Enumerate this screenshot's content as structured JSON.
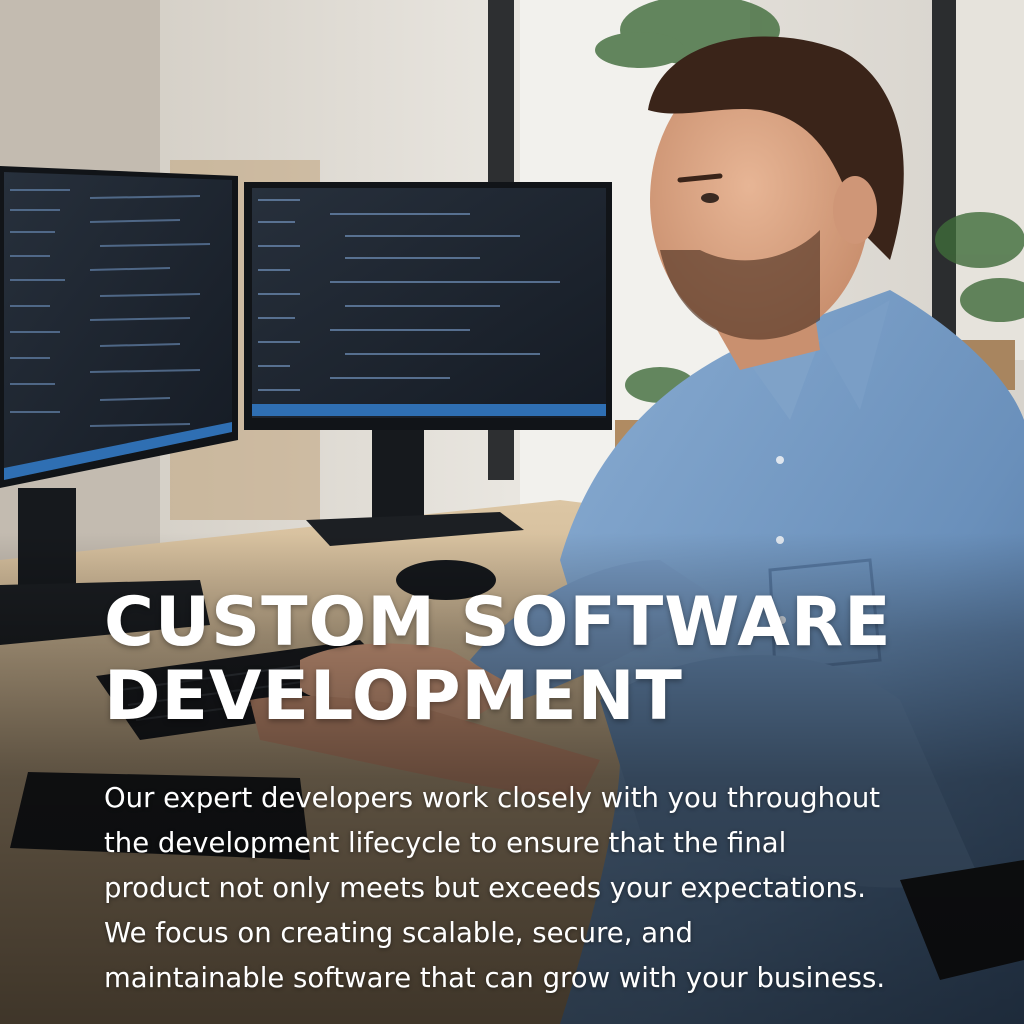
{
  "headline": {
    "line1": "CUSTOM SOFTWARE",
    "line2": "DEVELOPMENT"
  },
  "body": {
    "lines": [
      "Our expert developers work closely with you throughout",
      "the development lifecycle to ensure that the final",
      "product not only meets but exceeds your expectations.",
      "We focus on creating scalable, secure, and",
      "maintainable software that can grow with your business."
    ]
  },
  "colors": {
    "text": "#ffffff",
    "shirt": "#6f95bf",
    "desk": "#cfb692",
    "screen": "#1c2430"
  }
}
